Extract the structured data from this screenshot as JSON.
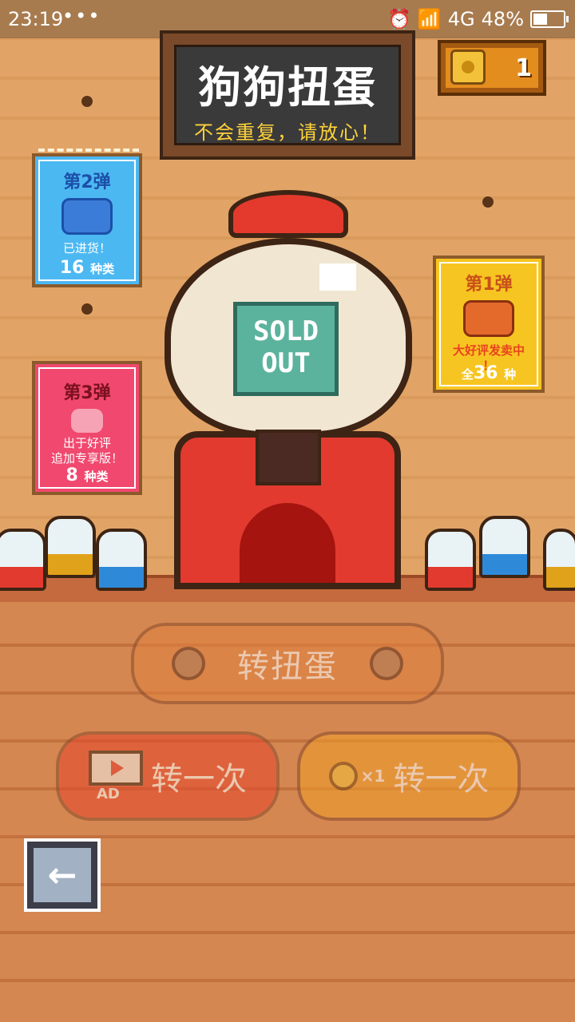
{
  "status_bar": {
    "time": "23:19",
    "dots": "•••",
    "network": "4G",
    "battery_percent": "48%",
    "battery_level": 0.48
  },
  "title_board": {
    "title": "狗狗扭蛋",
    "subtitle": "不会重复，请放心！"
  },
  "coins": {
    "count": "1"
  },
  "posters": [
    {
      "title": "第2弹",
      "text": "已进货！",
      "count": "16",
      "count_unit": "种类",
      "color": "#4cb8f2"
    },
    {
      "title": "第3弹",
      "text_line1": "出于好评",
      "text_line2": "追加专享版！",
      "count": "8",
      "count_unit": "种类",
      "color": "#f0486e"
    },
    {
      "title": "第1弹",
      "text": "大好评发卖中",
      "text2": "！",
      "count_prefix": "全",
      "count": "36",
      "count_unit": "种",
      "color": "#f7c521"
    }
  ],
  "machine": {
    "sold_out_line1": "SOLD",
    "sold_out_line2": "OUT"
  },
  "buttons": {
    "spin_label": "转扭蛋",
    "ad_label": "转一次",
    "ad_badge": "AD",
    "coin_label": "转一次",
    "coin_multiplier": "×1"
  },
  "back_icon": "left-arrow-icon"
}
